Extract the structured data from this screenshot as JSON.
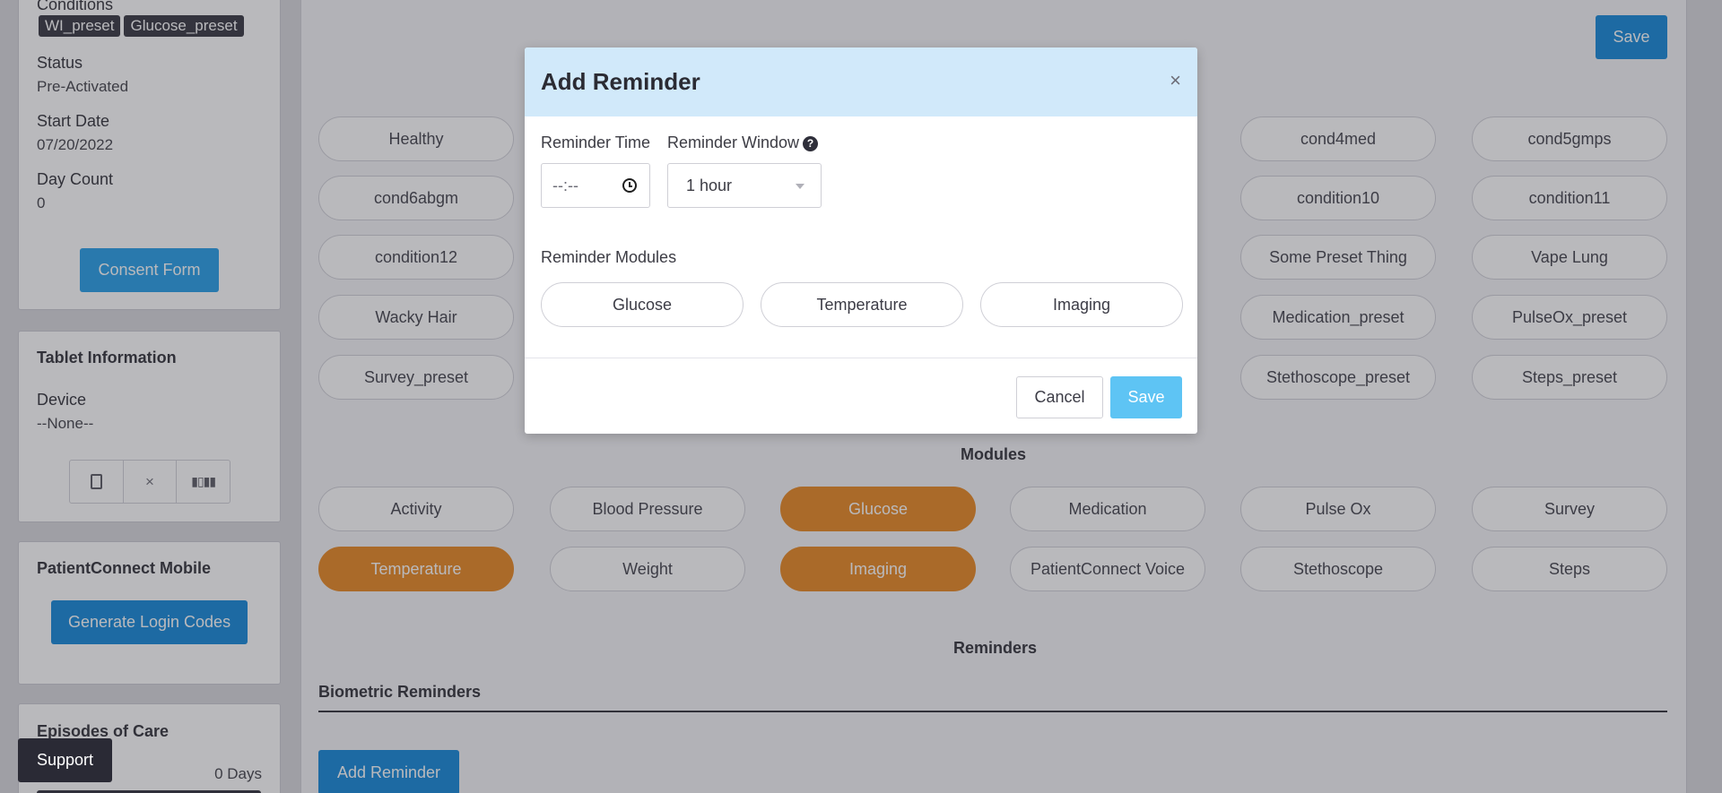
{
  "sidebar": {
    "conditions_label": "Conditions",
    "condition_tags": [
      "WI_preset",
      "Glucose_preset"
    ],
    "status_label": "Status",
    "status_value": "Pre-Activated",
    "start_date_label": "Start Date",
    "start_date_value": "07/20/2022",
    "day_count_label": "Day Count",
    "day_count_value": "0",
    "consent_button": "Consent Form",
    "tablet_title": "Tablet Information",
    "device_label": "Device",
    "device_value": "--None--",
    "mobile_title": "PatientConnect Mobile",
    "generate_button": "Generate Login Codes",
    "episodes_title": "Episodes of Care",
    "episodes_days": "0 Days",
    "support_button": "Support"
  },
  "main": {
    "save_button": "Save",
    "conditions_visible": [
      "Healthy",
      "cond4med",
      "cond5gmps",
      "cond6abgm",
      "condition10",
      "condition11",
      "condition12",
      "Some Preset Thing",
      "Vape Lung",
      "Wacky Hair",
      "Medication_preset",
      "PulseOx_preset",
      "Survey_preset",
      "Stethoscope_preset",
      "Steps_preset"
    ],
    "modules_title": "Modules",
    "modules": [
      {
        "label": "Activity",
        "active": false
      },
      {
        "label": "Blood Pressure",
        "active": false
      },
      {
        "label": "Glucose",
        "active": true
      },
      {
        "label": "Medication",
        "active": false
      },
      {
        "label": "Pulse Ox",
        "active": false
      },
      {
        "label": "Survey",
        "active": false
      },
      {
        "label": "Temperature",
        "active": true
      },
      {
        "label": "Weight",
        "active": false
      },
      {
        "label": "Imaging",
        "active": true
      },
      {
        "label": "PatientConnect Voice",
        "active": false
      },
      {
        "label": "Stethoscope",
        "active": false
      },
      {
        "label": "Steps",
        "active": false
      }
    ],
    "reminders_title": "Reminders",
    "biometric_reminders": "Biometric Reminders",
    "add_reminder_button": "Add Reminder"
  },
  "modal": {
    "title": "Add Reminder",
    "close": "×",
    "time_label": "Reminder Time",
    "time_placeholder": "--:--",
    "window_label": "Reminder Window",
    "window_value": "1 hour",
    "help_glyph": "?",
    "modules_label": "Reminder Modules",
    "modules": [
      "Glucose",
      "Temperature",
      "Imaging"
    ],
    "cancel_button": "Cancel",
    "save_button": "Save"
  },
  "icons": [
    "clock-icon",
    "help-icon",
    "close-icon",
    "tablet-icon",
    "remove-icon",
    "barcode-icon",
    "chevron-down-icon"
  ]
}
